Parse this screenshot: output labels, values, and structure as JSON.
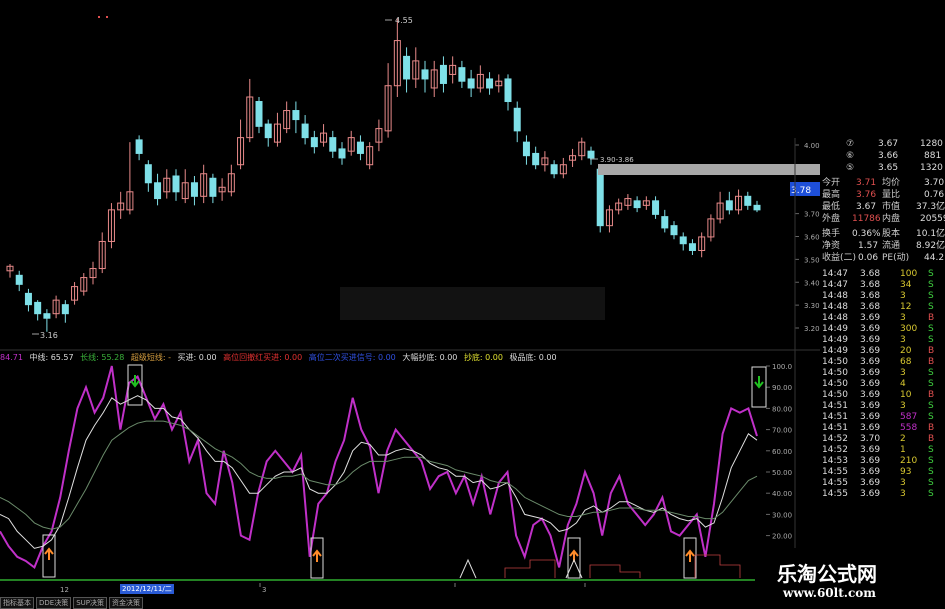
{
  "window": {
    "title": ""
  },
  "main_chart": {
    "price_ticks": [
      "4.00",
      "3.90",
      "3.80",
      "3.70",
      "3.60",
      "3.50",
      "3.40",
      "3.30",
      "3.20"
    ],
    "current_price_tag": "3.78",
    "high_label": "4.55",
    "low_label": "3.16",
    "range_label": "3.90-3.86"
  },
  "chart_data": [
    {
      "type": "candlestick",
      "title": "",
      "ylabel": "",
      "ylim": [
        3.15,
        4.03
      ],
      "annotations": [
        "4.55",
        "3.16",
        "3.90-3.86"
      ],
      "candles": [
        {
          "o": 3.43,
          "c": 3.45,
          "h": 3.46,
          "l": 3.4
        },
        {
          "o": 3.41,
          "c": 3.37,
          "h": 3.43,
          "l": 3.34
        },
        {
          "o": 3.33,
          "c": 3.28,
          "h": 3.35,
          "l": 3.25
        },
        {
          "o": 3.29,
          "c": 3.24,
          "h": 3.3,
          "l": 3.21
        },
        {
          "o": 3.24,
          "c": 3.22,
          "h": 3.26,
          "l": 3.16
        },
        {
          "o": 3.24,
          "c": 3.3,
          "h": 3.32,
          "l": 3.22
        },
        {
          "o": 3.28,
          "c": 3.24,
          "h": 3.3,
          "l": 3.2
        },
        {
          "o": 3.3,
          "c": 3.36,
          "h": 3.38,
          "l": 3.28
        },
        {
          "o": 3.34,
          "c": 3.4,
          "h": 3.42,
          "l": 3.32
        },
        {
          "o": 3.4,
          "c": 3.44,
          "h": 3.47,
          "l": 3.37
        },
        {
          "o": 3.44,
          "c": 3.56,
          "h": 3.6,
          "l": 3.42
        },
        {
          "o": 3.56,
          "c": 3.7,
          "h": 3.73,
          "l": 3.53
        },
        {
          "o": 3.7,
          "c": 3.73,
          "h": 3.78,
          "l": 3.66
        },
        {
          "o": 3.7,
          "c": 3.78,
          "h": 4.0,
          "l": 3.68
        },
        {
          "o": 4.01,
          "c": 3.95,
          "h": 4.03,
          "l": 3.92
        },
        {
          "o": 3.9,
          "c": 3.82,
          "h": 3.92,
          "l": 3.78
        },
        {
          "o": 3.82,
          "c": 3.75,
          "h": 3.86,
          "l": 3.72
        },
        {
          "o": 3.78,
          "c": 3.84,
          "h": 3.88,
          "l": 3.75
        },
        {
          "o": 3.85,
          "c": 3.78,
          "h": 3.88,
          "l": 3.74
        },
        {
          "o": 3.75,
          "c": 3.82,
          "h": 3.88,
          "l": 3.73
        },
        {
          "o": 3.82,
          "c": 3.76,
          "h": 3.85,
          "l": 3.72
        },
        {
          "o": 3.76,
          "c": 3.86,
          "h": 3.9,
          "l": 3.73
        },
        {
          "o": 3.84,
          "c": 3.76,
          "h": 3.86,
          "l": 3.73
        },
        {
          "o": 3.78,
          "c": 3.8,
          "h": 3.84,
          "l": 3.74
        },
        {
          "o": 3.78,
          "c": 3.86,
          "h": 3.9,
          "l": 3.76
        },
        {
          "o": 3.9,
          "c": 4.02,
          "h": 4.1,
          "l": 3.88
        },
        {
          "o": 4.02,
          "c": 4.2,
          "h": 4.28,
          "l": 4.0
        },
        {
          "o": 4.18,
          "c": 4.07,
          "h": 4.2,
          "l": 4.04
        },
        {
          "o": 4.08,
          "c": 4.02,
          "h": 4.1,
          "l": 3.98
        },
        {
          "o": 4.0,
          "c": 4.08,
          "h": 4.13,
          "l": 3.98
        },
        {
          "o": 4.06,
          "c": 4.14,
          "h": 4.18,
          "l": 4.04
        },
        {
          "o": 4.14,
          "c": 4.1,
          "h": 4.18,
          "l": 4.04
        },
        {
          "o": 4.08,
          "c": 4.02,
          "h": 4.12,
          "l": 3.99
        },
        {
          "o": 4.02,
          "c": 3.98,
          "h": 4.05,
          "l": 3.95
        },
        {
          "o": 4.0,
          "c": 4.04,
          "h": 4.08,
          "l": 3.98
        },
        {
          "o": 4.02,
          "c": 3.96,
          "h": 4.05,
          "l": 3.93
        },
        {
          "o": 3.97,
          "c": 3.93,
          "h": 4.0,
          "l": 3.9
        },
        {
          "o": 3.96,
          "c": 4.02,
          "h": 4.05,
          "l": 3.94
        },
        {
          "o": 4.0,
          "c": 3.95,
          "h": 4.03,
          "l": 3.92
        },
        {
          "o": 3.9,
          "c": 3.98,
          "h": 4.0,
          "l": 3.88
        },
        {
          "o": 4.0,
          "c": 4.06,
          "h": 4.1,
          "l": 3.96
        },
        {
          "o": 4.05,
          "c": 4.25,
          "h": 4.35,
          "l": 4.02
        },
        {
          "o": 4.25,
          "c": 4.45,
          "h": 4.55,
          "l": 4.2
        },
        {
          "o": 4.38,
          "c": 4.28,
          "h": 4.42,
          "l": 4.22
        },
        {
          "o": 4.28,
          "c": 4.36,
          "h": 4.42,
          "l": 4.24
        },
        {
          "o": 4.32,
          "c": 4.28,
          "h": 4.36,
          "l": 4.22
        },
        {
          "o": 4.24,
          "c": 4.32,
          "h": 4.36,
          "l": 4.2
        },
        {
          "o": 4.34,
          "c": 4.26,
          "h": 4.38,
          "l": 4.22
        },
        {
          "o": 4.3,
          "c": 4.34,
          "h": 4.38,
          "l": 4.26
        },
        {
          "o": 4.33,
          "c": 4.27,
          "h": 4.36,
          "l": 4.24
        },
        {
          "o": 4.28,
          "c": 4.24,
          "h": 4.32,
          "l": 4.2
        },
        {
          "o": 4.24,
          "c": 4.3,
          "h": 4.34,
          "l": 4.22
        },
        {
          "o": 4.28,
          "c": 4.24,
          "h": 4.31,
          "l": 4.21
        },
        {
          "o": 4.25,
          "c": 4.27,
          "h": 4.3,
          "l": 4.22
        },
        {
          "o": 4.28,
          "c": 4.18,
          "h": 4.3,
          "l": 4.14
        },
        {
          "o": 4.15,
          "c": 4.05,
          "h": 4.18,
          "l": 4.0
        },
        {
          "o": 4.0,
          "c": 3.94,
          "h": 4.03,
          "l": 3.9
        },
        {
          "o": 3.95,
          "c": 3.9,
          "h": 3.98,
          "l": 3.88
        },
        {
          "o": 3.9,
          "c": 3.93,
          "h": 3.96,
          "l": 3.87
        },
        {
          "o": 3.9,
          "c": 3.86,
          "h": 3.92,
          "l": 3.84
        },
        {
          "o": 3.86,
          "c": 3.9,
          "h": 3.93,
          "l": 3.84
        },
        {
          "o": 3.92,
          "c": 3.94,
          "h": 3.97,
          "l": 3.89
        },
        {
          "o": 3.94,
          "c": 4.0,
          "h": 4.02,
          "l": 3.92
        },
        {
          "o": 3.96,
          "c": 3.93,
          "h": 3.98,
          "l": 3.9
        },
        {
          "o": 3.88,
          "c": 3.63,
          "h": 3.88,
          "l": 3.6
        },
        {
          "o": 3.63,
          "c": 3.7,
          "h": 3.72,
          "l": 3.6
        },
        {
          "o": 3.7,
          "c": 3.73,
          "h": 3.75,
          "l": 3.68
        },
        {
          "o": 3.72,
          "c": 3.75,
          "h": 3.77,
          "l": 3.7
        },
        {
          "o": 3.74,
          "c": 3.71,
          "h": 3.76,
          "l": 3.69
        },
        {
          "o": 3.72,
          "c": 3.74,
          "h": 3.76,
          "l": 3.7
        },
        {
          "o": 3.74,
          "c": 3.68,
          "h": 3.76,
          "l": 3.66
        },
        {
          "o": 3.67,
          "c": 3.62,
          "h": 3.7,
          "l": 3.6
        },
        {
          "o": 3.63,
          "c": 3.59,
          "h": 3.65,
          "l": 3.57
        },
        {
          "o": 3.58,
          "c": 3.55,
          "h": 3.6,
          "l": 3.52
        },
        {
          "o": 3.55,
          "c": 3.52,
          "h": 3.57,
          "l": 3.5
        },
        {
          "o": 3.52,
          "c": 3.58,
          "h": 3.6,
          "l": 3.49
        },
        {
          "o": 3.58,
          "c": 3.66,
          "h": 3.68,
          "l": 3.56
        },
        {
          "o": 3.66,
          "c": 3.73,
          "h": 3.78,
          "l": 3.64
        },
        {
          "o": 3.74,
          "c": 3.7,
          "h": 3.78,
          "l": 3.68
        },
        {
          "o": 3.7,
          "c": 3.76,
          "h": 3.79,
          "l": 3.68
        },
        {
          "o": 3.76,
          "c": 3.72,
          "h": 3.78,
          "l": 3.7
        },
        {
          "o": 3.72,
          "c": 3.7,
          "h": 3.74,
          "l": 3.69
        }
      ]
    },
    {
      "type": "line",
      "title": "",
      "ylabel": "",
      "ylim": [
        0,
        100
      ],
      "series": [
        {
          "name": "",
          "color": "#c030c8",
          "values": [
            22,
            15,
            10,
            8,
            5,
            15,
            22,
            38,
            60,
            80,
            90,
            78,
            85,
            100,
            70,
            92,
            95,
            85,
            75,
            82,
            70,
            78,
            55,
            65,
            40,
            35,
            60,
            45,
            20,
            18,
            40,
            55,
            60,
            55,
            50,
            58,
            10,
            35,
            40,
            55,
            65,
            85,
            70,
            62,
            40,
            60,
            70,
            65,
            60,
            55,
            42,
            48,
            50,
            40,
            48,
            35,
            48,
            30,
            45,
            50,
            20,
            10,
            25,
            28,
            20,
            5,
            25,
            35,
            50,
            40,
            20,
            40,
            48,
            35,
            30,
            25,
            30,
            38,
            22,
            20,
            25,
            30,
            10,
            35,
            68,
            80,
            78,
            80,
            67
          ]
        },
        {
          "name": "",
          "color": "#e0e0e0",
          "values": [
            30,
            28,
            22,
            18,
            14,
            15,
            18,
            25,
            38,
            52,
            65,
            72,
            78,
            85,
            82,
            84,
            86,
            84,
            80,
            80,
            76,
            75,
            70,
            66,
            60,
            55,
            55,
            52,
            46,
            40,
            40,
            44,
            48,
            50,
            50,
            52,
            42,
            40,
            40,
            44,
            50,
            60,
            64,
            63,
            58,
            58,
            60,
            61,
            60,
            58,
            54,
            52,
            51,
            48,
            48,
            45,
            46,
            42,
            43,
            45,
            38,
            30,
            29,
            28,
            26,
            22,
            23,
            26,
            32,
            34,
            31,
            33,
            36,
            36,
            34,
            32,
            31,
            33,
            30,
            28,
            27,
            28,
            24,
            26,
            38,
            52,
            60,
            68,
            65
          ]
        },
        {
          "name": "",
          "color": "#6a8a6a",
          "values": [
            38,
            36,
            33,
            30,
            26,
            24,
            23,
            24,
            28,
            35,
            42,
            50,
            58,
            65,
            68,
            71,
            73,
            74,
            74,
            74,
            73,
            72,
            70,
            67,
            64,
            61,
            59,
            57,
            54,
            50,
            48,
            47,
            47,
            48,
            48,
            49,
            46,
            45,
            44,
            44,
            46,
            50,
            53,
            55,
            55,
            55,
            56,
            57,
            57,
            57,
            55,
            54,
            53,
            51,
            50,
            49,
            48,
            46,
            45,
            45,
            42,
            38,
            36,
            34,
            32,
            30,
            29,
            29,
            30,
            31,
            31,
            32,
            33,
            33,
            33,
            32,
            32,
            32,
            31,
            30,
            29,
            29,
            28,
            28,
            31,
            36,
            41,
            46,
            48
          ]
        }
      ]
    }
  ],
  "osc_axis": {
    "ticks": [
      "100.0",
      "90.00",
      "80.00",
      "70.00",
      "60.00",
      "50.00",
      "40.00",
      "30.00",
      "20.00",
      "10.00"
    ]
  },
  "osc_indicators": {
    "i0": "84.71",
    "i1": "中线: 65.57",
    "i2": "长线: 55.28",
    "i3": "超级短线: -",
    "i4": "买进: 0.00",
    "i5": "高位回撤红买进: 0.00",
    "i6": "高位二次买进信号: 0.00",
    "i7": "大幅抄底: 0.00",
    "i8": "抄底: 0.00",
    "i9": "极品底: 0.00"
  },
  "date_axis": {
    "left_label": "12",
    "selected_date": "2012/12/11/二",
    "tick1": "3"
  },
  "tabs": [
    "指标基本",
    "DDE决策",
    "SUP决策",
    "资金决策"
  ],
  "quote_panel": {
    "rows": [
      {
        "a": "⑦",
        "b": "3.67",
        "c": "1280"
      },
      {
        "a": "⑥",
        "b": "3.66",
        "c": "881"
      },
      {
        "a": "⑤",
        "b": "3.65",
        "c": "1320"
      },
      {
        "a": "今开",
        "b": "3.71",
        "c": "均价",
        "d": "3.70"
      },
      {
        "a": "最高",
        "b": "3.76",
        "c": "量比",
        "d": "0.76"
      },
      {
        "a": "最低",
        "b": "3.67",
        "c": "市值",
        "d": "37.3亿"
      },
      {
        "a": "外盘",
        "b": "11786",
        "c": "内盘",
        "d": "20559"
      },
      {
        "a": "换手",
        "b": "0.36%",
        "c": "股本",
        "d": "10.1亿"
      },
      {
        "a": "净资",
        "b": "1.57",
        "c": "流通",
        "d": "8.92亿"
      },
      {
        "a": "收益(二)",
        "b": "0.06",
        "c": "PE(动)",
        "d": "44.2"
      }
    ],
    "trades": [
      {
        "t": "14:47",
        "p": "3.68",
        "v": "100",
        "s": "S"
      },
      {
        "t": "14:47",
        "p": "3.68",
        "v": "34",
        "s": "S"
      },
      {
        "t": "14:48",
        "p": "3.68",
        "v": "3",
        "s": "S"
      },
      {
        "t": "14:48",
        "p": "3.68",
        "v": "12",
        "s": "S"
      },
      {
        "t": "14:48",
        "p": "3.69",
        "v": "3",
        "s": "B"
      },
      {
        "t": "14:49",
        "p": "3.69",
        "v": "300",
        "s": "S"
      },
      {
        "t": "14:49",
        "p": "3.69",
        "v": "3",
        "s": "S"
      },
      {
        "t": "14:49",
        "p": "3.69",
        "v": "20",
        "s": "B"
      },
      {
        "t": "14:50",
        "p": "3.69",
        "v": "68",
        "s": "B"
      },
      {
        "t": "14:50",
        "p": "3.69",
        "v": "3",
        "s": "S"
      },
      {
        "t": "14:50",
        "p": "3.69",
        "v": "4",
        "s": "S"
      },
      {
        "t": "14:50",
        "p": "3.69",
        "v": "10",
        "s": "B"
      },
      {
        "t": "14:51",
        "p": "3.69",
        "v": "3",
        "s": "S"
      },
      {
        "t": "14:51",
        "p": "3.69",
        "v": "587",
        "s": "S"
      },
      {
        "t": "14:51",
        "p": "3.69",
        "v": "558",
        "s": "B"
      },
      {
        "t": "14:52",
        "p": "3.70",
        "v": "2",
        "s": "B"
      },
      {
        "t": "14:52",
        "p": "3.69",
        "v": "1",
        "s": "S"
      },
      {
        "t": "14:53",
        "p": "3.69",
        "v": "210",
        "s": "S"
      },
      {
        "t": "14:55",
        "p": "3.69",
        "v": "93",
        "s": "S"
      },
      {
        "t": "14:55",
        "p": "3.69",
        "v": "3",
        "s": "S"
      },
      {
        "t": "14:55",
        "p": "3.69",
        "v": "3",
        "s": "S"
      }
    ]
  },
  "colors": {
    "up": "#e88a8a",
    "down": "#7fe0e8",
    "magenta": "#c030c8",
    "price_tag": "#1e4fd8"
  },
  "brand": {
    "name": "乐淘公式网",
    "url": "www.60lt.com"
  }
}
